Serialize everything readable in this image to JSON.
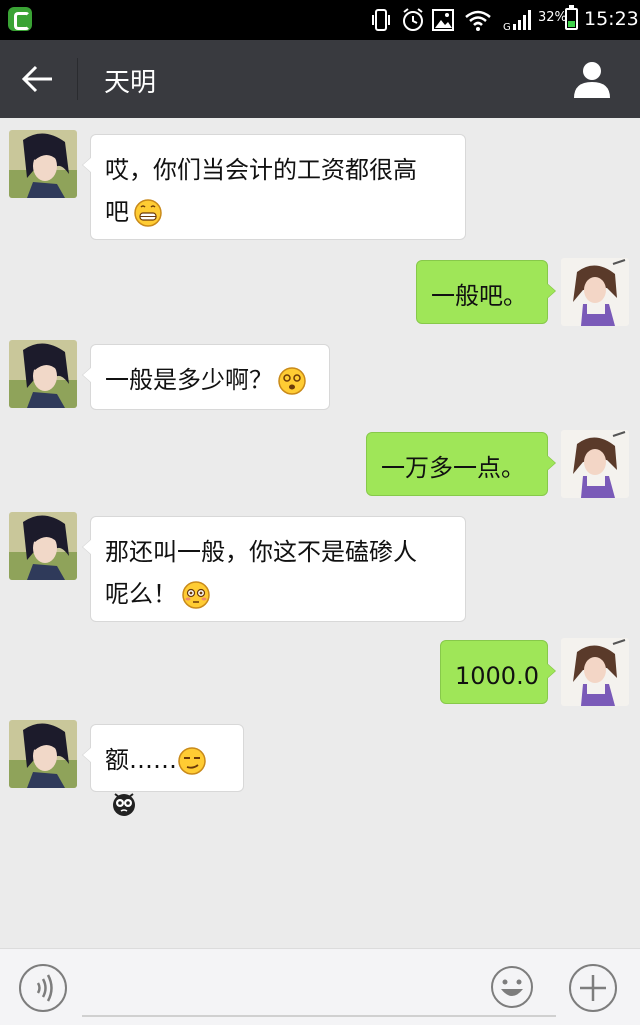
{
  "status_bar": {
    "battery_percent": "32%",
    "time": "15:23",
    "network": "G",
    "battery_level": 0.32
  },
  "header": {
    "title": "天明"
  },
  "messages": [
    {
      "side": "left",
      "text": "哎，你们当会计的工资都很高",
      "text2": "吧",
      "emoji": "grin-icon"
    },
    {
      "side": "right",
      "text": "一般吧。"
    },
    {
      "side": "left",
      "text": "一般是多少啊？",
      "emoji": "dizzy-face-icon"
    },
    {
      "side": "right",
      "text": "一万多一点。"
    },
    {
      "side": "left",
      "text": "那还叫一般，你这不是磕碜人",
      "text2": "呢么！",
      "emoji": "flushed-face-icon"
    },
    {
      "side": "right",
      "text": "1000.0"
    },
    {
      "side": "left",
      "text": "额……",
      "emoji": "smirk-face-icon",
      "emoji2": "black-creature-icon"
    }
  ],
  "input": {
    "placeholder": ""
  },
  "colors": {
    "header_bg": "#393a3f",
    "chat_bg": "#ebebeb",
    "sent_bubble": "#9fe658",
    "received_bubble": "#ffffff"
  }
}
